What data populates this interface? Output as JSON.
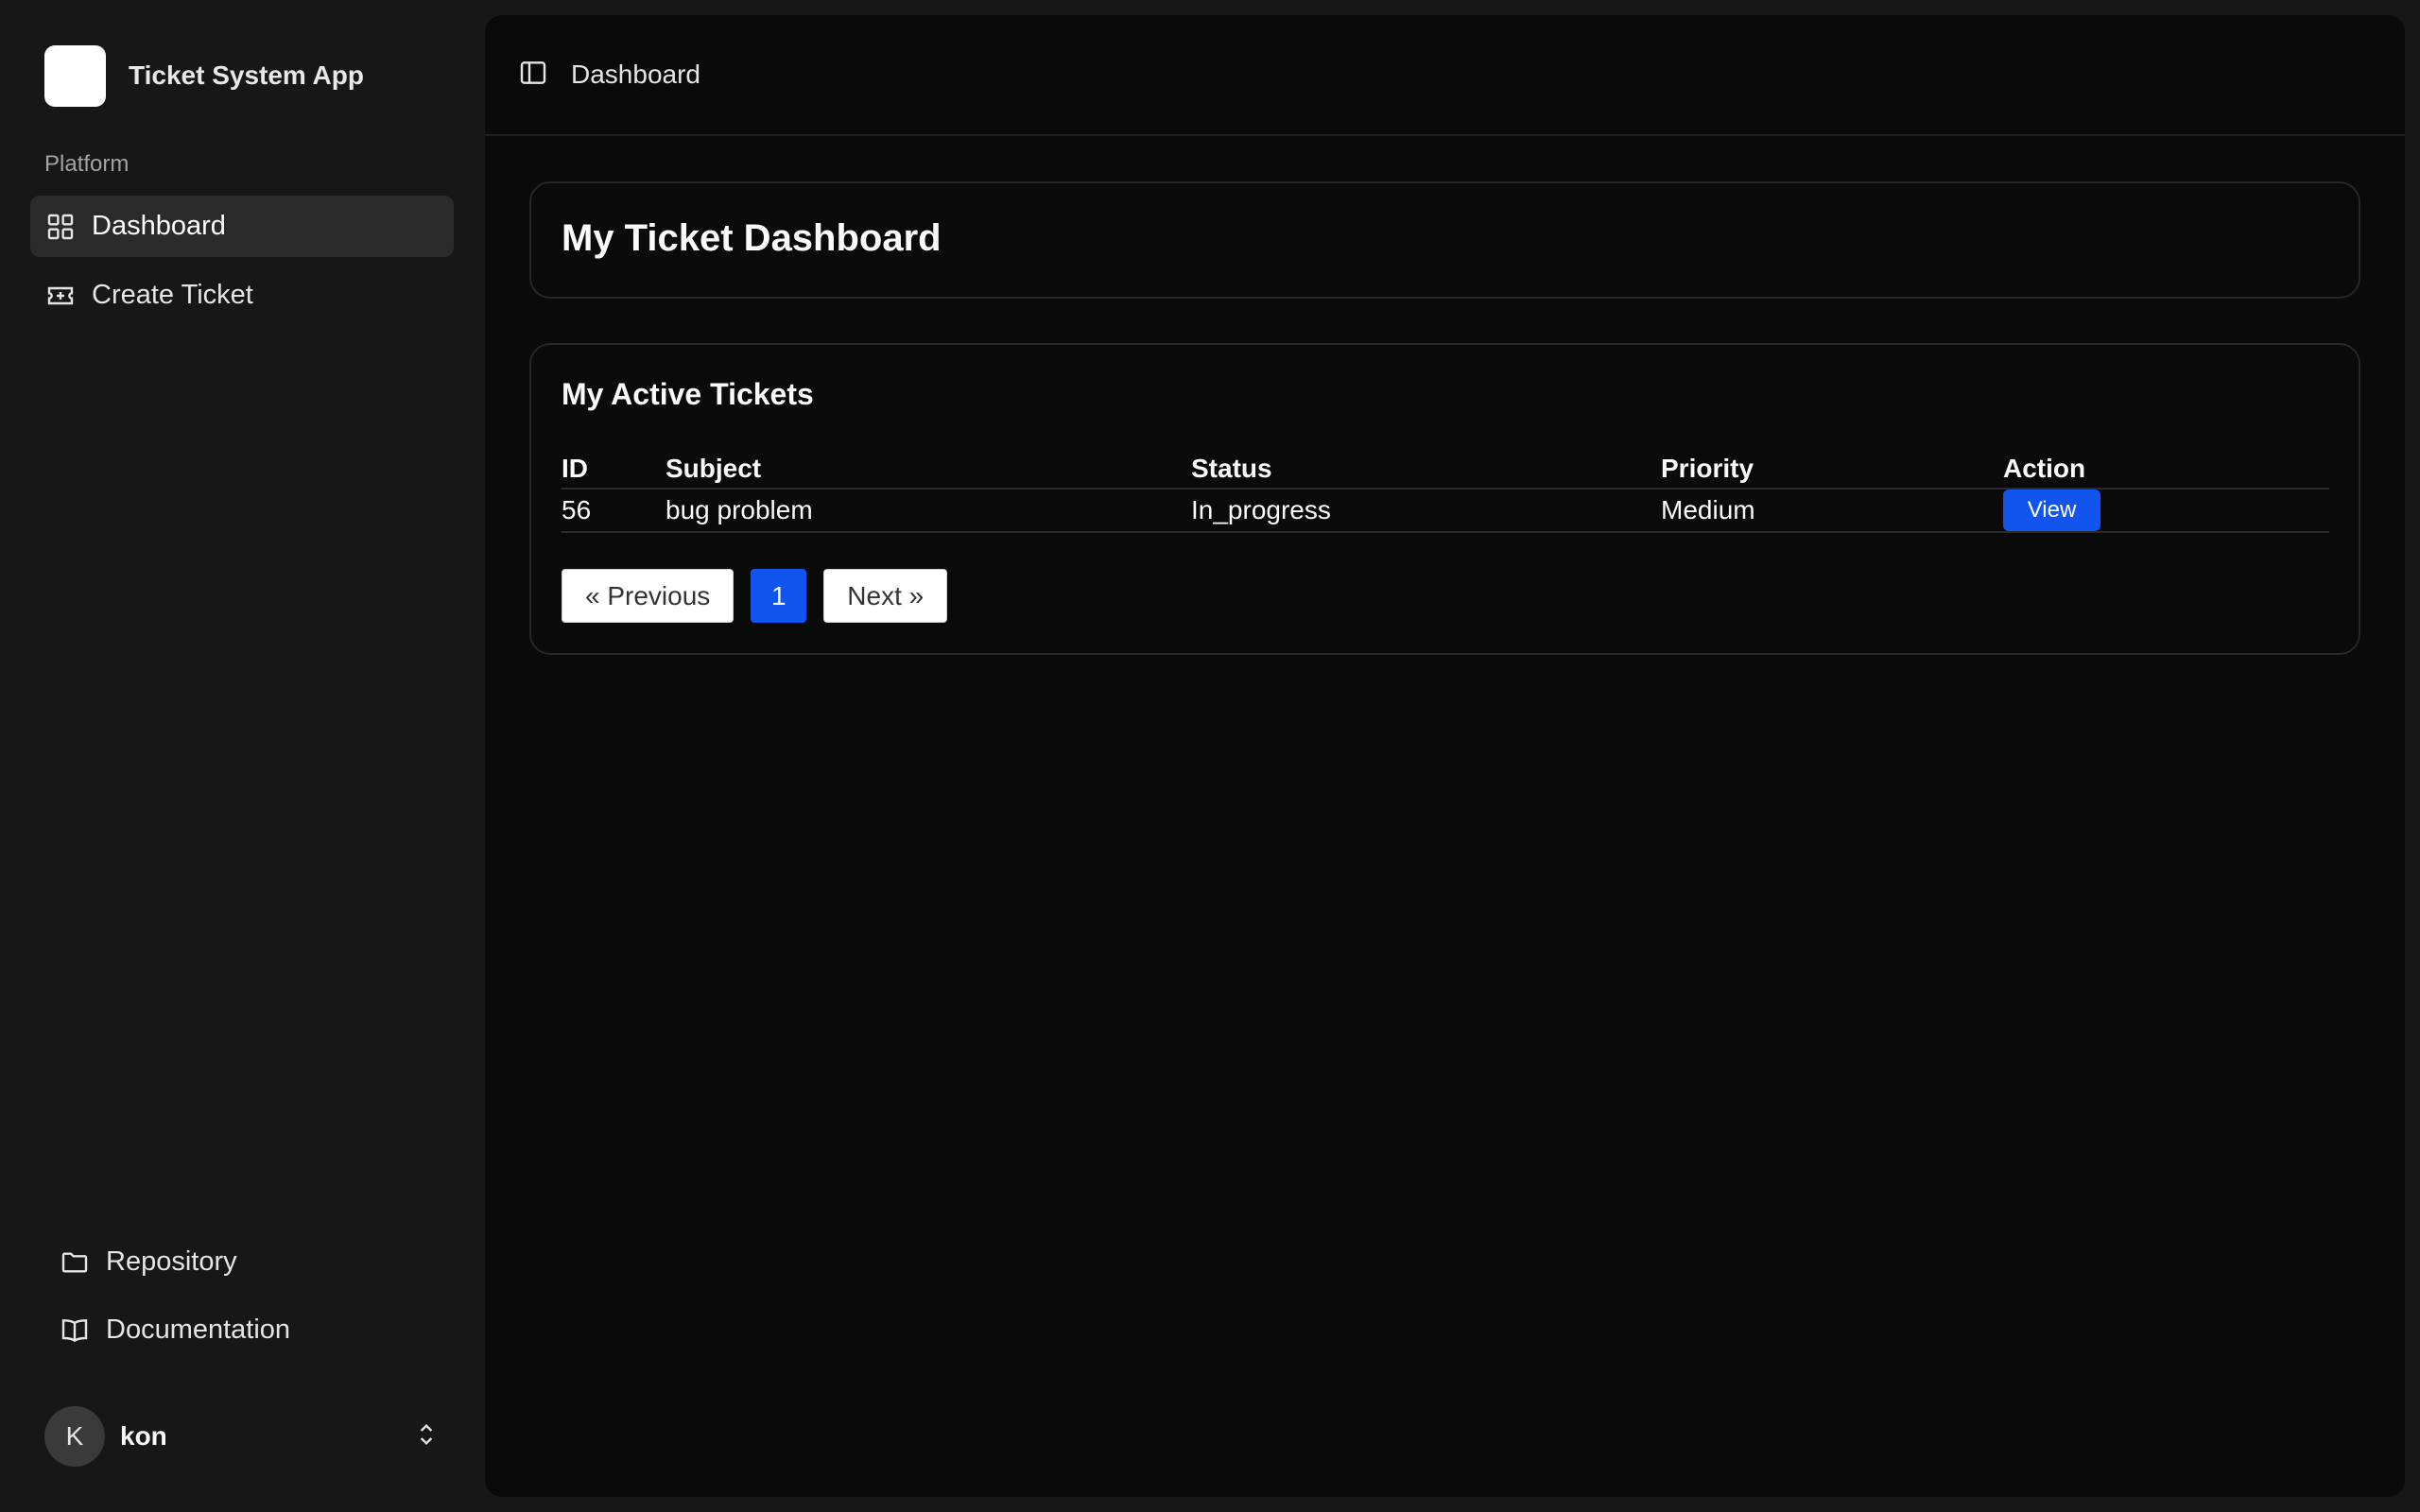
{
  "app": {
    "name": "Ticket System App"
  },
  "sidebar": {
    "group_label": "Platform",
    "items": [
      {
        "label": "Dashboard",
        "icon": "grid-icon",
        "active": true
      },
      {
        "label": "Create Ticket",
        "icon": "ticket-icon",
        "active": false
      }
    ],
    "footer_items": [
      {
        "label": "Repository",
        "icon": "folder-icon"
      },
      {
        "label": "Documentation",
        "icon": "book-icon"
      }
    ],
    "user": {
      "initial": "K",
      "name": "kon"
    }
  },
  "header": {
    "breadcrumb": "Dashboard"
  },
  "main": {
    "title": "My Ticket Dashboard",
    "tickets": {
      "title": "My Active Tickets",
      "columns": [
        "ID",
        "Subject",
        "Status",
        "Priority",
        "Action"
      ],
      "rows": [
        {
          "id": "56",
          "subject": "bug problem",
          "status": "In_progress",
          "priority": "Medium",
          "action": "View"
        }
      ],
      "pagination": {
        "previous": "« Previous",
        "current": "1",
        "next": "Next »"
      }
    }
  },
  "colors": {
    "accent": "#1155ee",
    "background": "#0a0a0a",
    "sidebar": "#171717"
  }
}
